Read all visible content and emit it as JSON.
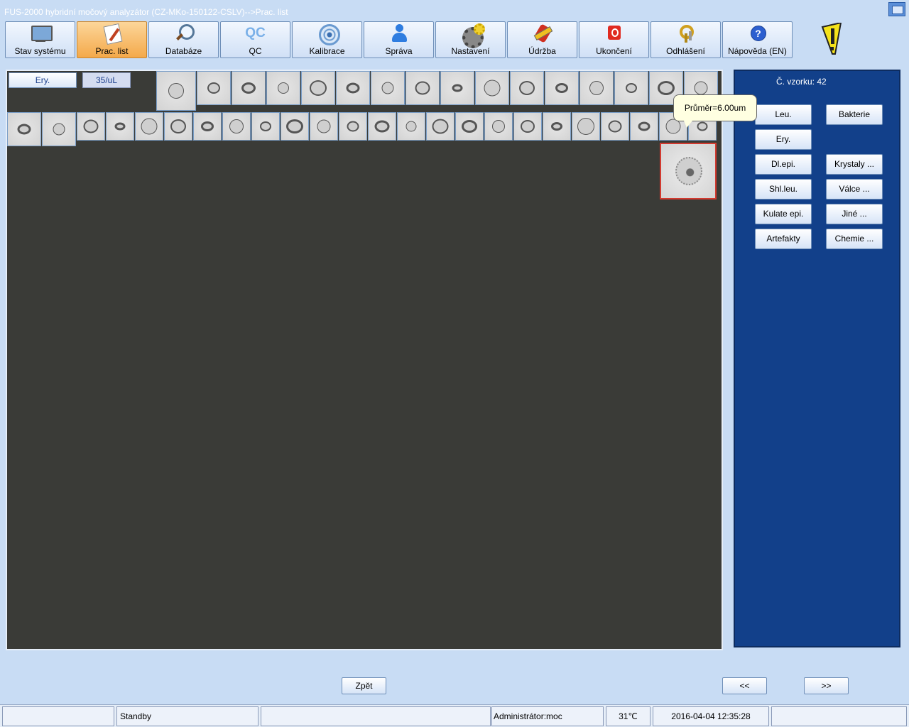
{
  "window": {
    "title": "FUS-2000 hybridní močový analyzátor (CZ-MKo-150122-CSLV)-->Prac. list"
  },
  "toolbar": {
    "buttons": [
      {
        "label": "Stav systému",
        "icon": "monitor-icon"
      },
      {
        "label": "Prac. list",
        "icon": "notepad-icon",
        "active": true
      },
      {
        "label": "Databáze",
        "icon": "magnifier-icon"
      },
      {
        "label": "QC",
        "icon": "qc-icon",
        "icon_text": "QC"
      },
      {
        "label": "Kalibrace",
        "icon": "target-icon"
      },
      {
        "label": "Správa",
        "icon": "person-icon"
      },
      {
        "label": "Nastavení",
        "icon": "gear-icon"
      },
      {
        "label": "Údržba",
        "icon": "tools-icon"
      },
      {
        "label": "Ukončení",
        "icon": "power-icon"
      },
      {
        "label": "Odhlášení",
        "icon": "keys-icon"
      },
      {
        "label": "Nápověda (EN)",
        "icon": "help-icon"
      }
    ]
  },
  "work": {
    "cell_type": "Ery.",
    "concentration": "35/uL",
    "tooltip": "Průměr=6.00um",
    "thumbnail_count_row1": 16,
    "thumbnail_count_row2": 25
  },
  "side": {
    "sample_number": "Č. vzorku: 42",
    "categories": {
      "leu": "Leu.",
      "bakterie": "Bakterie",
      "ery": "Ery.",
      "dl_epi": "Dl.epi.",
      "krystaly": "Krystaly ...",
      "shl_leu": "Shl.leu.",
      "valce": "Válce ...",
      "kulate_epi": "Kulate epi.",
      "jine": "Jiné ...",
      "artefakty": "Artefakty",
      "chemie": "Chemie ..."
    }
  },
  "nav": {
    "back": "Zpět",
    "prev": "<<",
    "next": ">>"
  },
  "status": {
    "cell1": "",
    "state": "Standby",
    "cell3": "",
    "user": "Administrátor:moc",
    "temperature": "31℃",
    "datetime": "2016-04-04 12:35:28"
  },
  "colors": {
    "background": "#c8dcf4",
    "work_panel": "#3a3b37",
    "side_panel": "#12408a",
    "active_tab": "#f4a94a",
    "selected_border": "#d23a30"
  }
}
